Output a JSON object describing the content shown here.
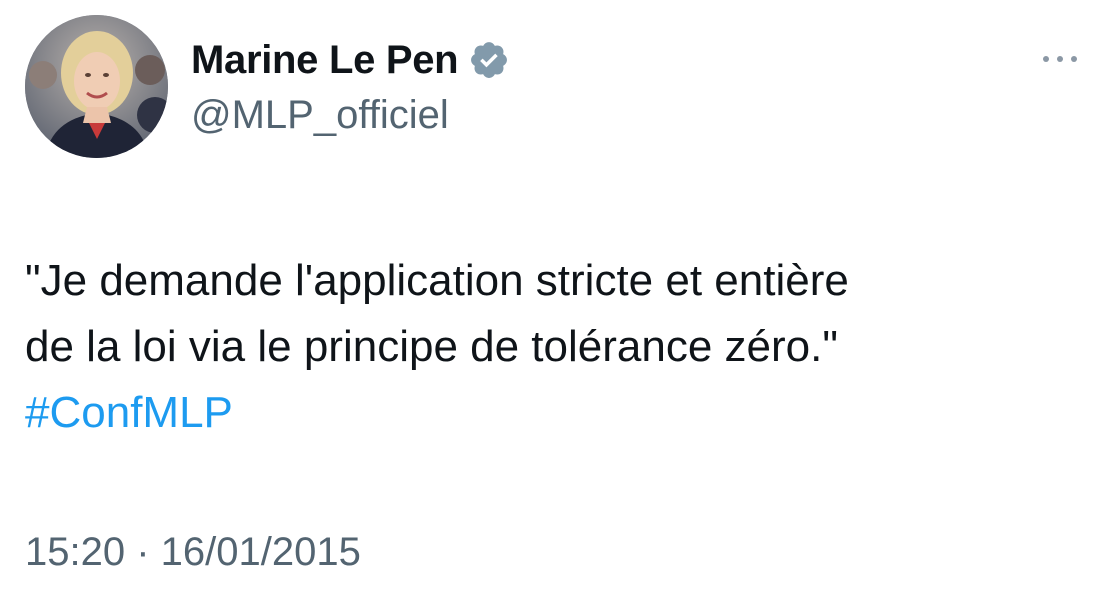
{
  "tweet": {
    "display_name": "Marine Le Pen",
    "handle": "@MLP_officiel",
    "verified_icon": "verified-badge-icon",
    "verified_color": "#829aab",
    "more_icon": "more-options-icon",
    "text_lines": [
      "\"Je demande l'application stricte et entière",
      "de la loi via le principe de tolérance zéro.\""
    ],
    "hashtag": "#ConfMLP",
    "hashtag_color": "#1d9bf0",
    "timestamp": "15:20 · 16/01/2015"
  }
}
